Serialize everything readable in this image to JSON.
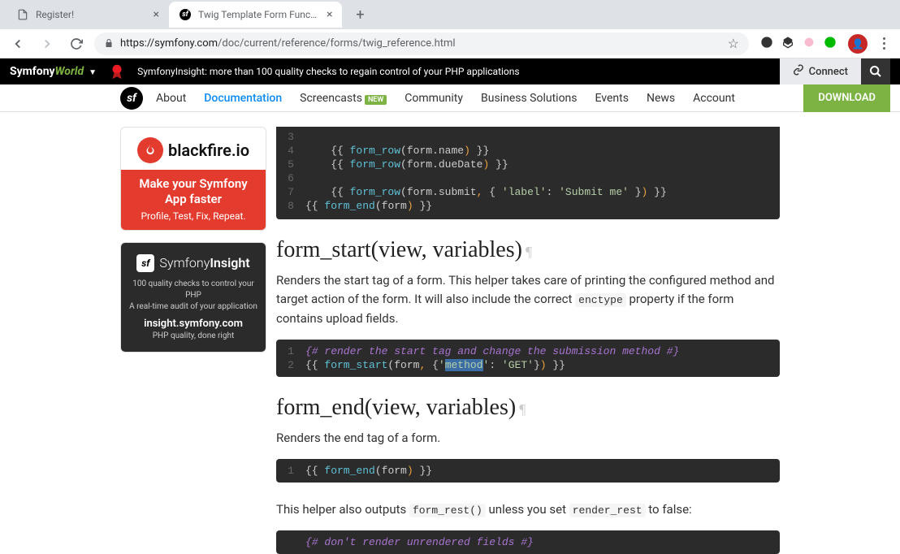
{
  "browser": {
    "tabs": [
      {
        "title": "Register!",
        "active": false
      },
      {
        "title": "Twig Template Form Function e",
        "active": true
      }
    ],
    "url_domain": "https://symfony.com",
    "url_path": "/doc/current/reference/forms/twig_reference.html"
  },
  "promo": {
    "brand_a": "Symfony",
    "brand_b": "World",
    "message": "SymfonyInsight: more than 100 quality checks to regain control of your PHP applications",
    "connect": "Connect"
  },
  "nav": {
    "items": [
      "About",
      "Documentation",
      "Screencasts",
      "Community",
      "Business Solutions",
      "Events",
      "News",
      "Account"
    ],
    "new_badge": "NEW",
    "download": "DOWNLOAD"
  },
  "ads": {
    "blackfire": {
      "name": "blackfire.io",
      "headline": "Make your Symfony App faster",
      "sub": "Profile, Test, Fix, Repeat."
    },
    "insight": {
      "brand_a": "Symfony",
      "brand_b": "Insight",
      "line1": "100 quality checks to control your PHP",
      "line2": "A real-time audit of your application",
      "url": "insight.symfony.com",
      "tag": "PHP quality, done right"
    }
  },
  "code1": {
    "lines": [
      {
        "n": "3",
        "tokens": []
      },
      {
        "n": "4",
        "tokens": [
          {
            "t": "    {{ ",
            "c": "tk-tag"
          },
          {
            "t": "form_row",
            "c": "tk-fn"
          },
          {
            "t": "(",
            "c": "tk-paren"
          },
          {
            "t": "form.name",
            "c": "tk-arg"
          },
          {
            "t": ")",
            "c": "tk-punct"
          },
          {
            "t": " }}",
            "c": "tk-tag"
          }
        ]
      },
      {
        "n": "5",
        "tokens": [
          {
            "t": "    {{ ",
            "c": "tk-tag"
          },
          {
            "t": "form_row",
            "c": "tk-fn"
          },
          {
            "t": "(",
            "c": "tk-paren"
          },
          {
            "t": "form.dueDate",
            "c": "tk-arg"
          },
          {
            "t": ")",
            "c": "tk-punct"
          },
          {
            "t": " }}",
            "c": "tk-tag"
          }
        ]
      },
      {
        "n": "6",
        "tokens": []
      },
      {
        "n": "7",
        "tokens": [
          {
            "t": "    {{ ",
            "c": "tk-tag"
          },
          {
            "t": "form_row",
            "c": "tk-fn"
          },
          {
            "t": "(",
            "c": "tk-paren"
          },
          {
            "t": "form.submit",
            "c": "tk-arg"
          },
          {
            "t": ", ",
            "c": "tk-punct"
          },
          {
            "t": "{ ",
            "c": "tk-brace"
          },
          {
            "t": "'label'",
            "c": "tk-str"
          },
          {
            "t": ": ",
            "c": "tk-brace"
          },
          {
            "t": "'Submit me'",
            "c": "tk-str"
          },
          {
            "t": " }",
            "c": "tk-brace"
          },
          {
            "t": ")",
            "c": "tk-punct"
          },
          {
            "t": " }}",
            "c": "tk-tag"
          }
        ]
      },
      {
        "n": "8",
        "tokens": [
          {
            "t": "{{ ",
            "c": "tk-tag"
          },
          {
            "t": "form_end",
            "c": "tk-fn"
          },
          {
            "t": "(",
            "c": "tk-paren"
          },
          {
            "t": "form",
            "c": "tk-arg"
          },
          {
            "t": ")",
            "c": "tk-punct"
          },
          {
            "t": " }}",
            "c": "tk-tag"
          }
        ]
      }
    ]
  },
  "section_form_start": {
    "heading": "form_start(view, variables)",
    "para_a": "Renders the start tag of a form. This helper takes care of printing the configured method and target action of the form. It will also include the correct ",
    "code_a": "enctype",
    "para_b": " property if the form contains upload fields."
  },
  "code2": {
    "lines": [
      {
        "n": "1",
        "tokens": [
          {
            "t": "{# render the start tag and change the submission method #}",
            "c": "tk-comment"
          }
        ]
      },
      {
        "n": "2",
        "tokens": [
          {
            "t": "{{ ",
            "c": "tk-tag"
          },
          {
            "t": "form_start",
            "c": "tk-fn"
          },
          {
            "t": "(",
            "c": "tk-paren"
          },
          {
            "t": "form",
            "c": "tk-arg"
          },
          {
            "t": ", ",
            "c": "tk-punct"
          },
          {
            "t": "{",
            "c": "tk-brace"
          },
          {
            "t": "'",
            "c": "tk-str"
          },
          {
            "t": "method",
            "c": "tk-key-str tk-sel"
          },
          {
            "t": "'",
            "c": "tk-str"
          },
          {
            "t": ": ",
            "c": "tk-brace"
          },
          {
            "t": "'GET'",
            "c": "tk-str"
          },
          {
            "t": "}",
            "c": "tk-brace"
          },
          {
            "t": ")",
            "c": "tk-punct"
          },
          {
            "t": " }}",
            "c": "tk-tag"
          }
        ]
      }
    ]
  },
  "section_form_end": {
    "heading": "form_end(view, variables)",
    "para": "Renders the end tag of a form."
  },
  "code3": {
    "lines": [
      {
        "n": "1",
        "tokens": [
          {
            "t": "{{ ",
            "c": "tk-tag"
          },
          {
            "t": "form_end",
            "c": "tk-fn"
          },
          {
            "t": "(",
            "c": "tk-paren"
          },
          {
            "t": "form",
            "c": "tk-arg"
          },
          {
            "t": ")",
            "c": "tk-punct"
          },
          {
            "t": " }}",
            "c": "tk-tag"
          }
        ]
      }
    ]
  },
  "trailing": {
    "para_a": "This helper also outputs ",
    "code_a": "form_rest()",
    "para_b": " unless you set ",
    "code_b": "render_rest",
    "para_c": " to false:"
  },
  "code4_comment": "{# don't render unrendered fields #}"
}
